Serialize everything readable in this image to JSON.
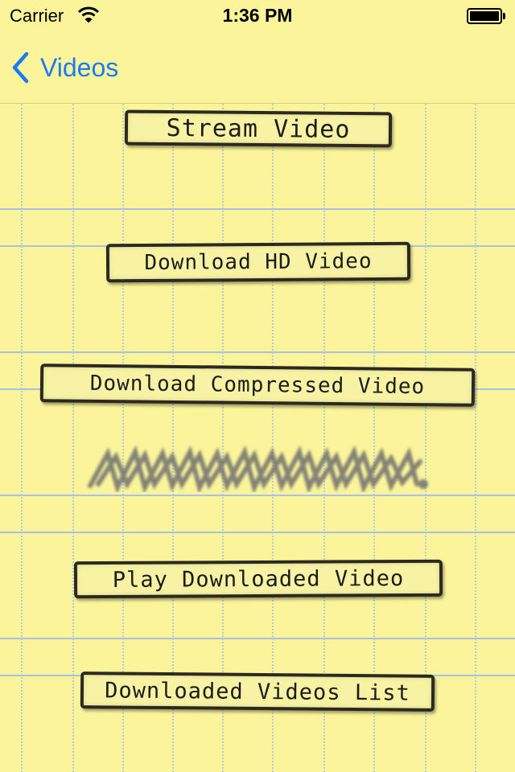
{
  "status_bar": {
    "carrier": "Carrier",
    "time": "1:36 PM"
  },
  "nav": {
    "back_label": "Videos",
    "accent_color": "#1a7cf5"
  },
  "buttons": {
    "stream": "Stream Video",
    "download_hd": "Download HD Video",
    "download_compressed": "Download Compressed Video",
    "play_downloaded": "Play Downloaded Video",
    "downloaded_list": "Downloaded Videos List"
  },
  "theme": {
    "paper_color": "#fbf49a",
    "rule_color": "#a7c2e8"
  },
  "icons": {
    "wifi": "wifi-icon",
    "battery": "battery-icon",
    "back": "chevron-left-icon",
    "scribble": "scribble-progress-icon"
  }
}
